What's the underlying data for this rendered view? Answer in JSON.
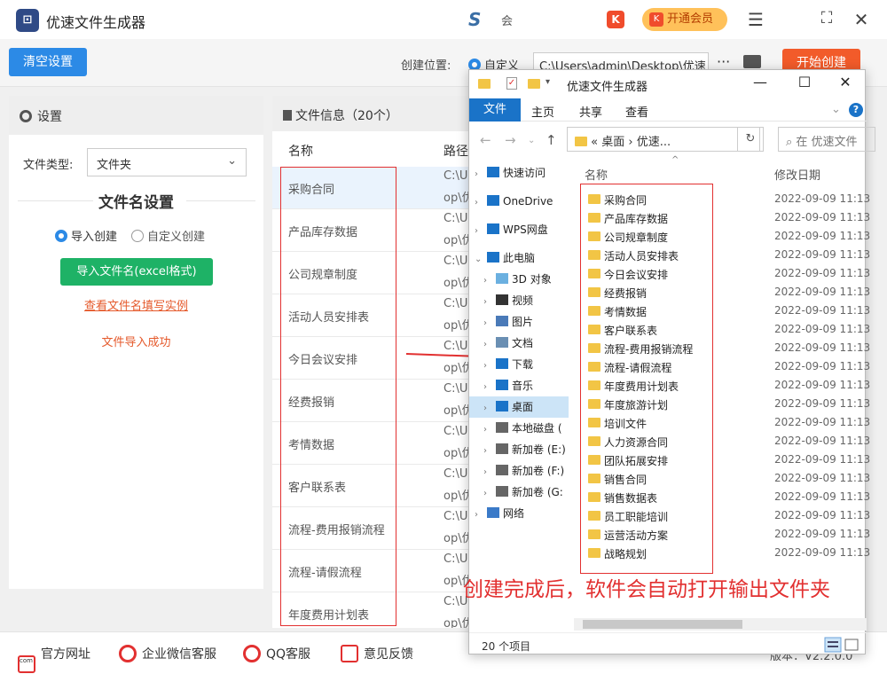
{
  "app": {
    "title": "优速文件生成器",
    "center_logo": "S",
    "center_text": "会",
    "k_badge": "K",
    "vip_label": "开通会员",
    "menu_icon": "☰",
    "max_icon": "⛶",
    "close_icon": "✕"
  },
  "toolbar": {
    "clear_label": "清空设置",
    "location_label": "创建位置:",
    "custom_label": "自定义",
    "path_value": "C:\\Users\\admin\\Desktop\\优速",
    "more_label": "···",
    "start_label": "开始创建"
  },
  "settings": {
    "title": "设置",
    "file_type_label": "文件类型:",
    "file_type_value": "文件夹",
    "name_settings_title": "文件名设置",
    "import_create_label": "导入创建",
    "custom_create_label": "自定义创建",
    "import_button": "导入文件名(excel格式)",
    "example_link": "查看文件名填写实例",
    "success_text": "文件导入成功"
  },
  "file_info": {
    "title": "文件信息（20个）",
    "col_name": "名称",
    "col_path": "路径",
    "path_line1": "C:\\U",
    "path_line2": "op\\优",
    "rows": [
      "采购合同",
      "产品库存数据",
      "公司规章制度",
      "活动人员安排表",
      "今日会议安排",
      "经费报销",
      "考情数据",
      "客户联系表",
      "流程-费用报销流程",
      "流程-请假流程",
      "年度费用计划表"
    ]
  },
  "bottom": {
    "website": "官方网址",
    "wechat": "企业微信客服",
    "qq": "QQ客服",
    "feedback": "意见反馈",
    "version": "版本：V2.2.0.0",
    "com_text": "com"
  },
  "explorer": {
    "title": "优速文件生成器",
    "ribbon_file": "文件",
    "ribbon_home": "主页",
    "ribbon_share": "共享",
    "ribbon_view": "查看",
    "help": "?",
    "address": "« 桌面 › 优速...",
    "refresh": "↻",
    "search_placeholder": "在 优速文件",
    "col_name": "名称",
    "col_date": "修改日期",
    "nav": [
      "快速访问",
      "OneDrive",
      "WPS网盘",
      "此电脑",
      "3D 对象",
      "视频",
      "图片",
      "文档",
      "下载",
      "音乐",
      "桌面",
      "本地磁盘 (",
      "新加卷 (E:)",
      "新加卷 (F:)",
      "新加卷 (G:",
      "网络"
    ],
    "date": "2022-09-09 11:13",
    "items": [
      "采购合同",
      "产品库存数据",
      "公司规章制度",
      "活动人员安排表",
      "今日会议安排",
      "经费报销",
      "考情数据",
      "客户联系表",
      "流程-费用报销流程",
      "流程-请假流程",
      "年度费用计划表",
      "年度旅游计划",
      "培训文件",
      "人力资源合同",
      "团队拓展安排",
      "销售合同",
      "销售数据表",
      "员工职能培训",
      "运营活动方案",
      "战略规划"
    ],
    "status": "20 个项目",
    "note": "创建完成后，软件会自动打开输出文件夹"
  },
  "colors": {
    "primary": "#2c8ae6",
    "start": "#f25b2a",
    "green": "#1eb266",
    "red": "#e23030",
    "folder": "#f2c545"
  }
}
